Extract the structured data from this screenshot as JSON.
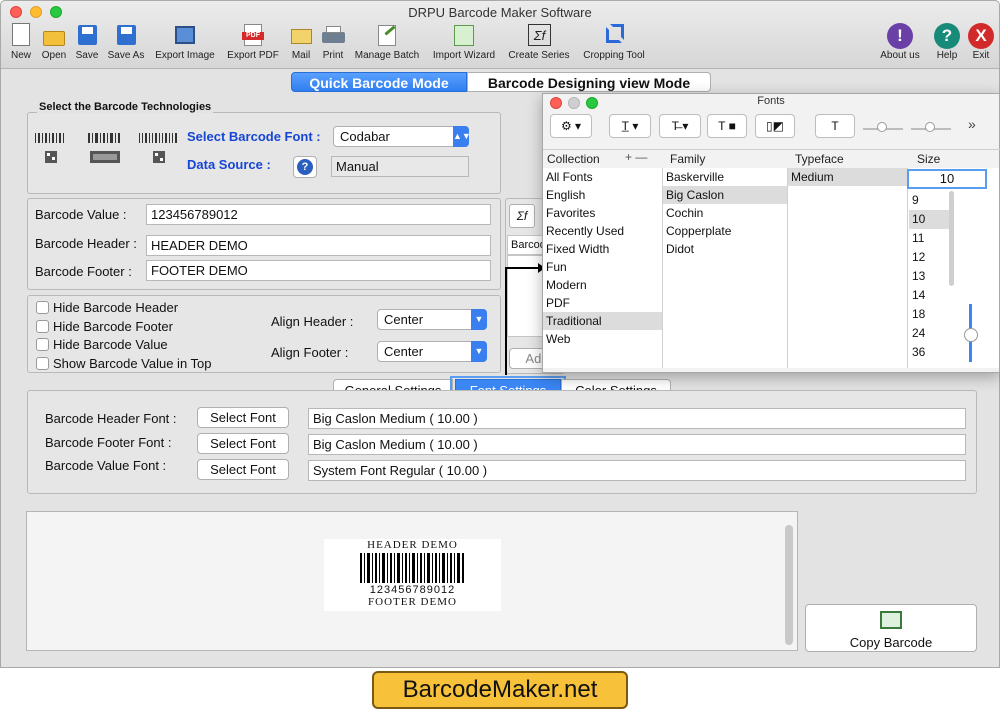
{
  "app": {
    "title": "DRPU Barcode Maker Software"
  },
  "toolbar": {
    "items": [
      {
        "label": "New",
        "icon": "new-document-icon"
      },
      {
        "label": "Open",
        "icon": "open-folder-icon"
      },
      {
        "label": "Save",
        "icon": "save-disk-icon"
      },
      {
        "label": "Save As",
        "icon": "save-as-icon"
      },
      {
        "label": "Export Image",
        "icon": "export-image-icon"
      },
      {
        "label": "Export PDF",
        "icon": "export-pdf-icon"
      },
      {
        "label": "Mail",
        "icon": "mail-icon"
      },
      {
        "label": "Print",
        "icon": "printer-icon"
      },
      {
        "label": "Manage Batch",
        "icon": "manage-batch-icon"
      },
      {
        "label": "Import Wizard",
        "icon": "import-wizard-icon"
      },
      {
        "label": "Create Series",
        "icon": "create-series-icon"
      },
      {
        "label": "Cropping Tool",
        "icon": "crop-icon"
      },
      {
        "label": "About us",
        "icon": "about-icon"
      },
      {
        "label": "Help",
        "icon": "help-icon"
      },
      {
        "label": "Exit",
        "icon": "exit-icon"
      }
    ]
  },
  "modes": {
    "quick": "Quick Barcode Mode",
    "designing": "Barcode Designing view Mode"
  },
  "technologies": {
    "section_title": "Select the Barcode Technologies",
    "font_label": "Select Barcode Font :",
    "font_value": "Codabar",
    "source_label": "Data Source :",
    "source_value": "Manual"
  },
  "fields": {
    "value_label": "Barcode Value :",
    "value": "123456789012",
    "header_label": "Barcode Header :",
    "header": "HEADER DEMO",
    "footer_label": "Barcode Footer :",
    "footer": "FOOTER DEMO"
  },
  "options": {
    "checkboxes": [
      "Hide Barcode Header",
      "Hide Barcode Footer",
      "Hide Barcode Value",
      "Show Barcode Value in Top"
    ],
    "align_header_label": "Align Header :",
    "align_header": "Center",
    "align_footer_label": "Align Footer :",
    "align_footer": "Center"
  },
  "side": {
    "series_symbol": "Σf",
    "column_label": "Barcod",
    "add_label": "Add"
  },
  "tabs": [
    "General Settings",
    "Font Settings",
    "Color Settings"
  ],
  "font_settings": {
    "header_label": "Barcode Header Font :",
    "header_value": "Big Caslon Medium ( 10.00 )",
    "footer_label": "Barcode Footer Font :",
    "footer_value": "Big Caslon Medium ( 10.00 )",
    "value_label": "Barcode Value Font :",
    "value_value": "System Font Regular ( 10.00 )",
    "select_button": "Select Font"
  },
  "preview": {
    "header": "HEADER DEMO",
    "value": "123456789012",
    "footer": "FOOTER DEMO"
  },
  "copy_button": "Copy Barcode",
  "fonts_panel": {
    "title": "Fonts",
    "collection_header": "Collection",
    "family_header": "Family",
    "typeface_header": "Typeface",
    "size_header": "Size",
    "collections": [
      "All Fonts",
      "English",
      "Favorites",
      "Recently Used",
      "Fixed Width",
      "Fun",
      "Modern",
      "PDF",
      "Traditional",
      "Web"
    ],
    "selected_collection": "Traditional",
    "families": [
      "Baskerville",
      "Big Caslon",
      "Cochin",
      "Copperplate",
      "Didot"
    ],
    "selected_family": "Big Caslon",
    "typefaces": [
      "Medium"
    ],
    "size_value": "10",
    "sizes": [
      "9",
      "10",
      "11",
      "12",
      "13",
      "14",
      "18",
      "24",
      "36"
    ],
    "selected_size": "10",
    "add_remove": "+ —"
  },
  "watermark": "BarcodeMaker.net",
  "colors": {
    "accent": "#3a7ff0",
    "link_blue": "#1746d6",
    "watermark_bg": "#f7c23a"
  }
}
